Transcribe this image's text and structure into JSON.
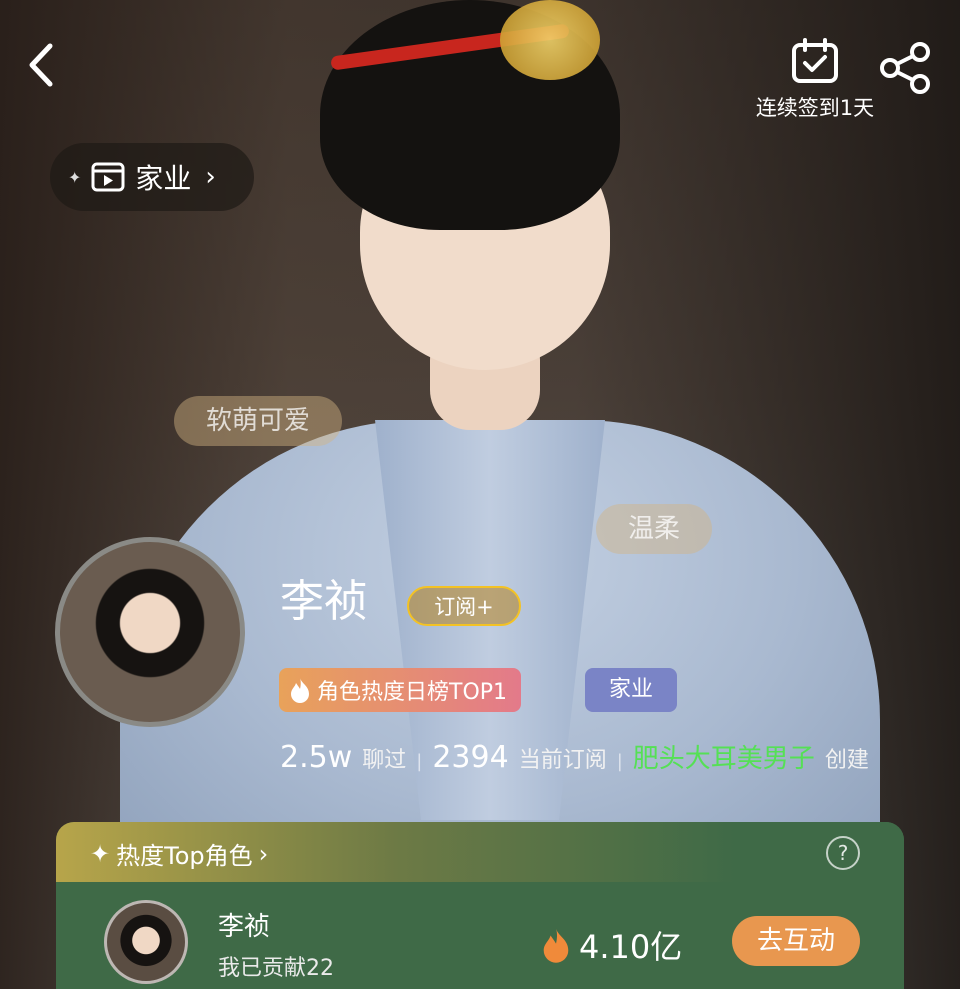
{
  "header": {
    "back_icon": "chevron-left-icon",
    "checkin_label": "连续签到1天",
    "checkin_icon": "calendar-check-icon",
    "share_icon": "share-icon"
  },
  "category": {
    "label": "家业",
    "icon": "play-box-icon"
  },
  "floating_tags": [
    "软萌可爱",
    "温柔"
  ],
  "profile": {
    "name": "李祯",
    "subscribe_label": "订阅+",
    "rank_badge": "角色热度日榜TOP1",
    "category_badge": "家业",
    "chat_count": "2.5w",
    "chat_label": "聊过",
    "sub_count": "2394",
    "sub_label": "当前订阅",
    "creator": "肥头大耳美男子",
    "creator_suffix": "创建"
  },
  "hot_panel": {
    "title": "热度Top角色",
    "help": "?",
    "row": {
      "name": "李祯",
      "contribution": "我已贡献22",
      "heat_value": "4.10亿",
      "action_label": "去互动"
    }
  },
  "colors": {
    "creator": "#55e055",
    "subscribe_border": "#f3c224",
    "panel_bg": "#3f6a47",
    "action_btn": "#e8974f"
  }
}
